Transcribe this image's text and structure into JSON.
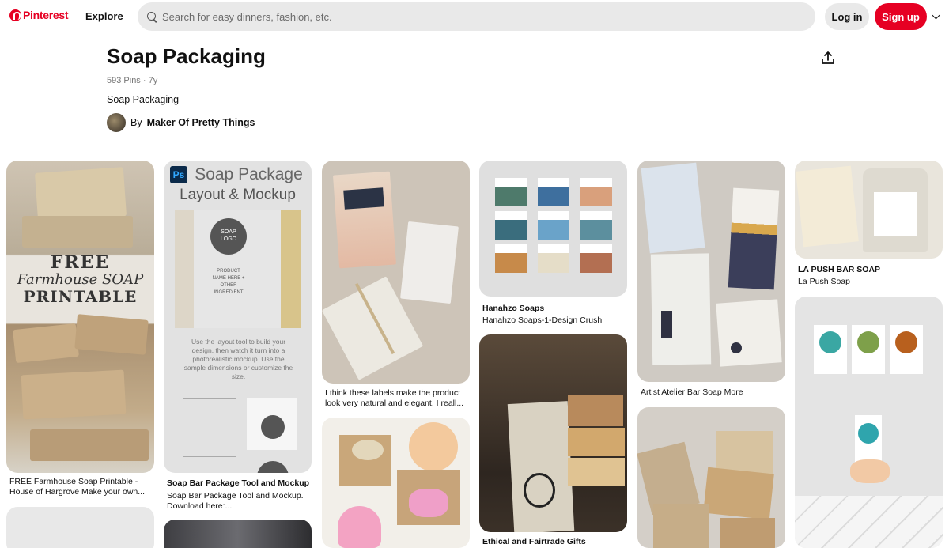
{
  "header": {
    "logo_text": "Pinterest",
    "explore_label": "Explore",
    "search_placeholder": "Search for easy dinners, fashion, etc.",
    "login_label": "Log in",
    "signup_label": "Sign up"
  },
  "board": {
    "title": "Soap Packaging",
    "meta": "593 Pins · 7y",
    "description": "Soap Packaging",
    "by_prefix": "By",
    "owner": "Maker Of Pretty Things"
  },
  "pins": [
    {
      "title": "",
      "desc": "FREE Farmhouse Soap Printable -\nHouse of Hargrove Make your own...",
      "image_text": [
        "FREE",
        "Farmhouse SOAP",
        "PRINTABLE"
      ]
    },
    {
      "title": "Soap Bar Package Tool and Mockup",
      "desc": "Soap Bar Package Tool and Mockup.\nDownload here:...",
      "image_text": [
        "Soap Package",
        "Layout & Mockup",
        "SOAP LOGO",
        "PRODUCT NAME HERE + OTHER INGREDIENT",
        "Use the layout tool to build your design, then watch it turn into a photorealistic mockup. Use the sample dimensions or customize the size."
      ]
    },
    {
      "title": "",
      "desc": "I think these labels make the product\nlook very natural and elegant. I reall..."
    },
    {
      "title": "Hanahzo Soaps",
      "desc": "Hanahzo Soaps-1-Design Crush"
    },
    {
      "title": "",
      "desc": "Artist Atelier Bar Soap More"
    },
    {
      "title": "LA PUSH BAR SOAP",
      "desc": "La Push Soap"
    },
    {
      "title": "Ethical and Fairtrade Gifts",
      "desc": ""
    }
  ],
  "colors": {
    "brand": "#e60023",
    "search_bg": "#e9e9e9"
  }
}
